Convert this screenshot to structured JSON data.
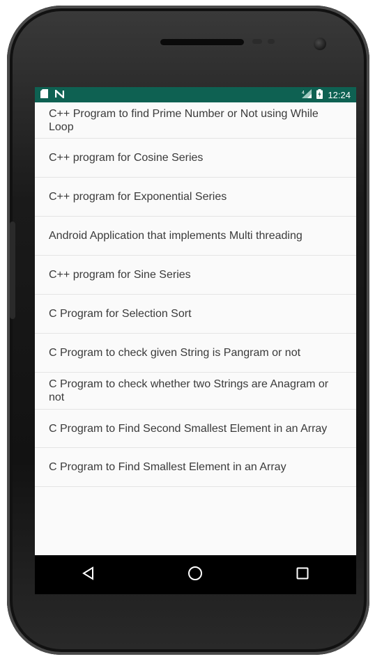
{
  "status_bar": {
    "time": "12:24",
    "background": "#0e6152"
  },
  "list": {
    "items": [
      {
        "label": "C++ Program to find Prime Number or Not using While Loop"
      },
      {
        "label": "C++ program for Cosine Series"
      },
      {
        "label": "C++ program for Exponential Series"
      },
      {
        "label": "Android Application that implements Multi threading"
      },
      {
        "label": "C++ program for Sine Series"
      },
      {
        "label": "C Program for Selection Sort"
      },
      {
        "label": "C Program to check given String is Pangram or not"
      },
      {
        "label": "C Program to check whether two Strings are Anagram or not"
      },
      {
        "label": "C Program to Find Second Smallest Element in an Array"
      },
      {
        "label": "C Program to Find Smallest Element in an Array"
      }
    ]
  },
  "nav_bar": {
    "back_icon": "back-triangle-icon",
    "home_icon": "home-circle-icon",
    "recents_icon": "recents-square-icon"
  }
}
